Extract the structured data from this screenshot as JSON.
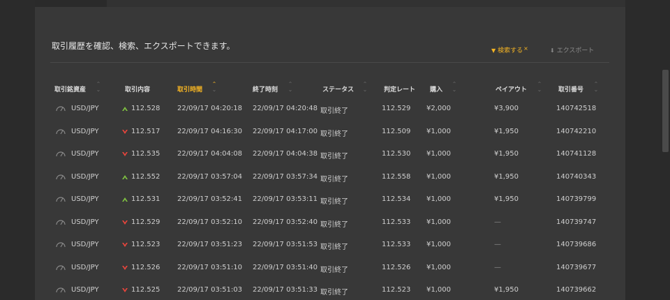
{
  "intro_text": "取引履歴を確認、検索、エクスポートできます。",
  "actions": {
    "search_label": "検索する",
    "export_label": "エクスポート"
  },
  "colors": {
    "accent": "#f5b423",
    "up": "#7fc241",
    "down": "#e8453c",
    "panel": "#383838",
    "background": "#2b2b2b"
  },
  "table": {
    "columns": [
      {
        "key": "asset",
        "label": "取引銘資産",
        "sortable": true
      },
      {
        "key": "content",
        "label": "取引内容",
        "sortable": false
      },
      {
        "key": "trade_time",
        "label": "取引時間",
        "sortable": true,
        "active": true
      },
      {
        "key": "end_time",
        "label": "終了時刻",
        "sortable": true
      },
      {
        "key": "status",
        "label": "ステータス",
        "sortable": true
      },
      {
        "key": "rate",
        "label": "判定レート",
        "sortable": false
      },
      {
        "key": "purchase",
        "label": "購入",
        "sortable": true
      },
      {
        "key": "payout",
        "label": "ペイアウト",
        "sortable": true
      },
      {
        "key": "trade_no",
        "label": "取引番号",
        "sortable": true
      }
    ],
    "rows": [
      {
        "asset": "USD/JPY",
        "direction": "up",
        "entry": "112.528",
        "trade_time": "22/09/17 04:20:18",
        "end_time": "22/09/17 04:20:48",
        "status": "取引終了",
        "rate": "112.529",
        "purchase": "¥2,000",
        "payout": "¥3,900",
        "trade_no": "140742518"
      },
      {
        "asset": "USD/JPY",
        "direction": "down",
        "entry": "112.517",
        "trade_time": "22/09/17 04:16:30",
        "end_time": "22/09/17 04:17:00",
        "status": "取引終了",
        "rate": "112.509",
        "purchase": "¥1,000",
        "payout": "¥1,950",
        "trade_no": "140742210"
      },
      {
        "asset": "USD/JPY",
        "direction": "down",
        "entry": "112.535",
        "trade_time": "22/09/17 04:04:08",
        "end_time": "22/09/17 04:04:38",
        "status": "取引終了",
        "rate": "112.530",
        "purchase": "¥1,000",
        "payout": "¥1,950",
        "trade_no": "140741128"
      },
      {
        "asset": "USD/JPY",
        "direction": "up",
        "entry": "112.552",
        "trade_time": "22/09/17 03:57:04",
        "end_time": "22/09/17 03:57:34",
        "status": "取引終了",
        "rate": "112.558",
        "purchase": "¥1,000",
        "payout": "¥1,950",
        "trade_no": "140740343"
      },
      {
        "asset": "USD/JPY",
        "direction": "up",
        "entry": "112.531",
        "trade_time": "22/09/17 03:52:41",
        "end_time": "22/09/17 03:53:11",
        "status": "取引終了",
        "rate": "112.534",
        "purchase": "¥1,000",
        "payout": "¥1,950",
        "trade_no": "140739799"
      },
      {
        "asset": "USD/JPY",
        "direction": "down",
        "entry": "112.529",
        "trade_time": "22/09/17 03:52:10",
        "end_time": "22/09/17 03:52:40",
        "status": "取引終了",
        "rate": "112.533",
        "purchase": "¥1,000",
        "payout": "—",
        "trade_no": "140739747"
      },
      {
        "asset": "USD/JPY",
        "direction": "down",
        "entry": "112.523",
        "trade_time": "22/09/17 03:51:23",
        "end_time": "22/09/17 03:51:53",
        "status": "取引終了",
        "rate": "112.533",
        "purchase": "¥1,000",
        "payout": "—",
        "trade_no": "140739686"
      },
      {
        "asset": "USD/JPY",
        "direction": "down",
        "entry": "112.526",
        "trade_time": "22/09/17 03:51:10",
        "end_time": "22/09/17 03:51:40",
        "status": "取引終了",
        "rate": "112.526",
        "purchase": "¥1,000",
        "payout": "—",
        "trade_no": "140739677"
      },
      {
        "asset": "USD/JPY",
        "direction": "down",
        "entry": "112.525",
        "trade_time": "22/09/17 03:51:03",
        "end_time": "22/09/17 03:51:33",
        "status": "取引終了",
        "rate": "112.523",
        "purchase": "¥1,000",
        "payout": "¥1,950",
        "trade_no": "140739662"
      }
    ]
  }
}
